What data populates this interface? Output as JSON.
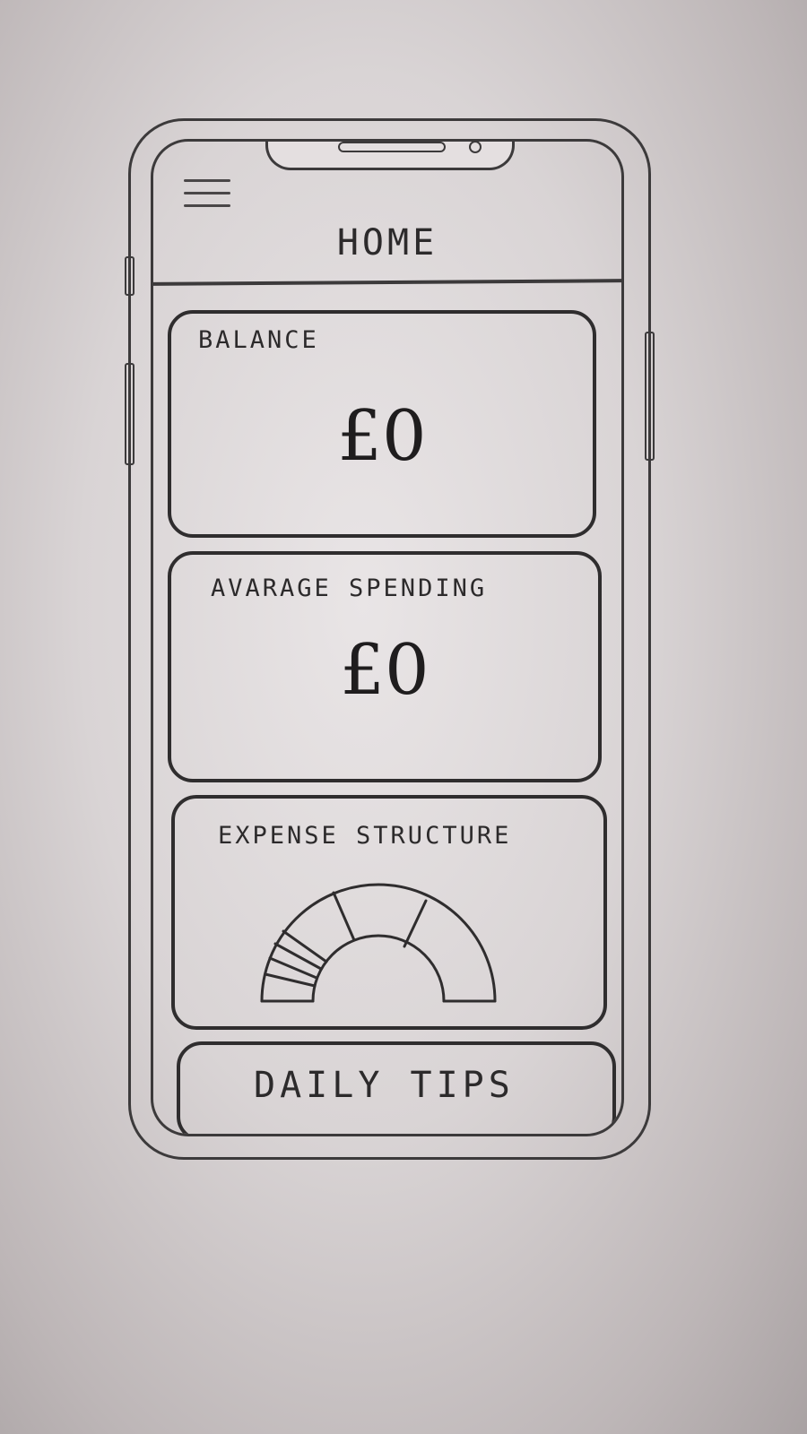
{
  "header": {
    "menu_icon": "hamburger-menu-icon",
    "title": "HOME"
  },
  "cards": {
    "balance": {
      "label": "BALANCE",
      "value": "£0"
    },
    "average_spending": {
      "label": "AVARAGE SPENDING",
      "value": "£0"
    },
    "expense_structure": {
      "label": "EXPENSE STRUCTURE",
      "chart_icon": "semicircle-donut-chart"
    },
    "daily_tips": {
      "label": "DAILY TIPS"
    }
  },
  "colors": {
    "ink": "#2c2a2b",
    "paper": "#e4dfe0"
  }
}
